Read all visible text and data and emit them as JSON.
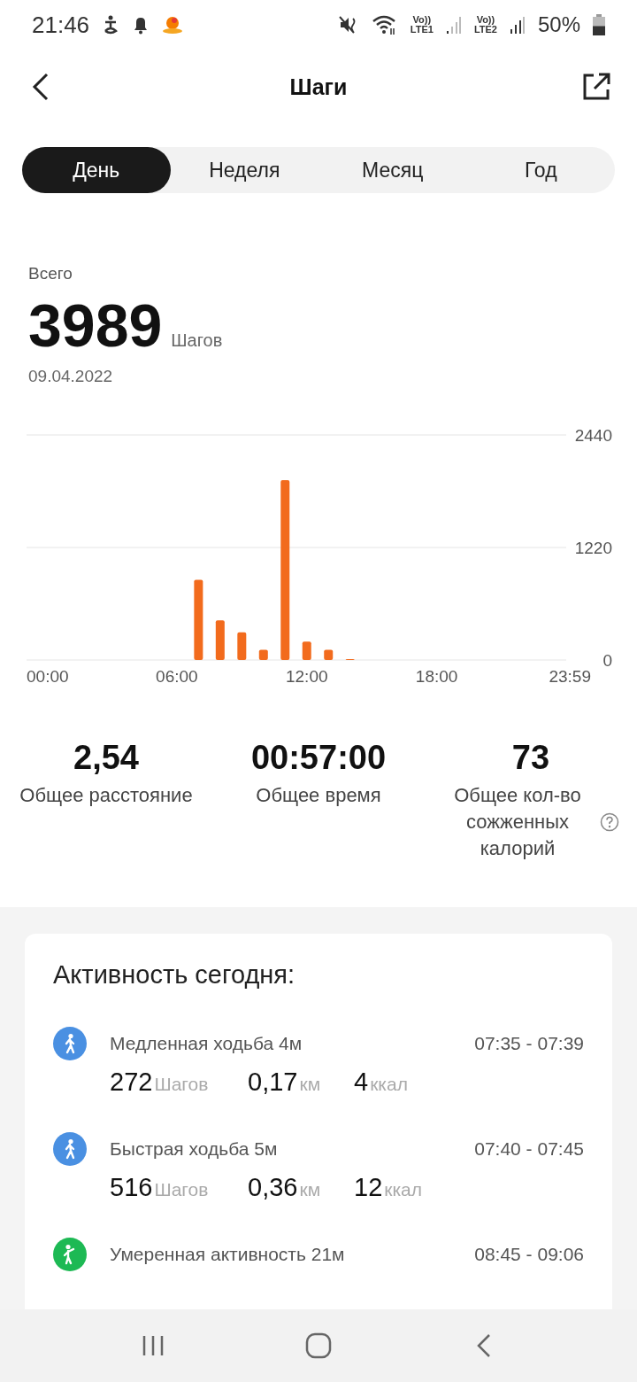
{
  "status_bar": {
    "time": "21:46",
    "sim1": {
      "volte": "Vo))",
      "label": "LTE1"
    },
    "sim2": {
      "volte": "Vo))",
      "label": "LTE2"
    },
    "battery": "50%"
  },
  "header": {
    "title": "Шаги"
  },
  "tabs": [
    {
      "label": "День",
      "selected": true
    },
    {
      "label": "Неделя",
      "selected": false
    },
    {
      "label": "Месяц",
      "selected": false
    },
    {
      "label": "Год",
      "selected": false
    }
  ],
  "summary": {
    "caption": "Всего",
    "value": "3989",
    "unit": "Шагов",
    "date": "09.04.2022"
  },
  "chart_data": {
    "type": "bar",
    "x": [
      7,
      8,
      9,
      10,
      11,
      12,
      13,
      14
    ],
    "values": [
      870,
      430,
      300,
      110,
      1950,
      200,
      110,
      10
    ],
    "xlim": [
      -0.94,
      23.98
    ],
    "ylim": [
      0,
      2440
    ],
    "xticks": [
      {
        "value": 0,
        "label": "00:00"
      },
      {
        "value": 6,
        "label": "06:00"
      },
      {
        "value": 12,
        "label": "12:00"
      },
      {
        "value": 18,
        "label": "18:00"
      },
      {
        "value": 23.98,
        "label": "23:59"
      }
    ],
    "yticks": [
      0,
      1220,
      2440
    ]
  },
  "stats": [
    {
      "value": "2,54",
      "label": "Общее расстояние",
      "help": false
    },
    {
      "value": "00:57:00",
      "label": "Общее время",
      "help": false
    },
    {
      "value": "73",
      "label": "Общее кол-во сожженных калорий",
      "help": true
    }
  ],
  "activity": {
    "title": "Активность сегодня:",
    "items": [
      {
        "kind": "walk",
        "color": "#4a90e2",
        "name": "Медленная ходьба 4м",
        "time": "07:35 - 07:39",
        "steps": "272",
        "steps_unit": "Шагов",
        "distance": "0,17",
        "distance_unit": "км",
        "calories": "4",
        "calories_unit": "ккал"
      },
      {
        "kind": "walk",
        "color": "#4a90e2",
        "name": "Быстрая ходьба 5м",
        "time": "07:40 - 07:45",
        "steps": "516",
        "steps_unit": "Шагов",
        "distance": "0,36",
        "distance_unit": "км",
        "calories": "12",
        "calories_unit": "ккал"
      },
      {
        "kind": "active",
        "color": "#1db954",
        "name": "Умеренная активность 21м",
        "time": "08:45 - 09:06"
      }
    ]
  }
}
